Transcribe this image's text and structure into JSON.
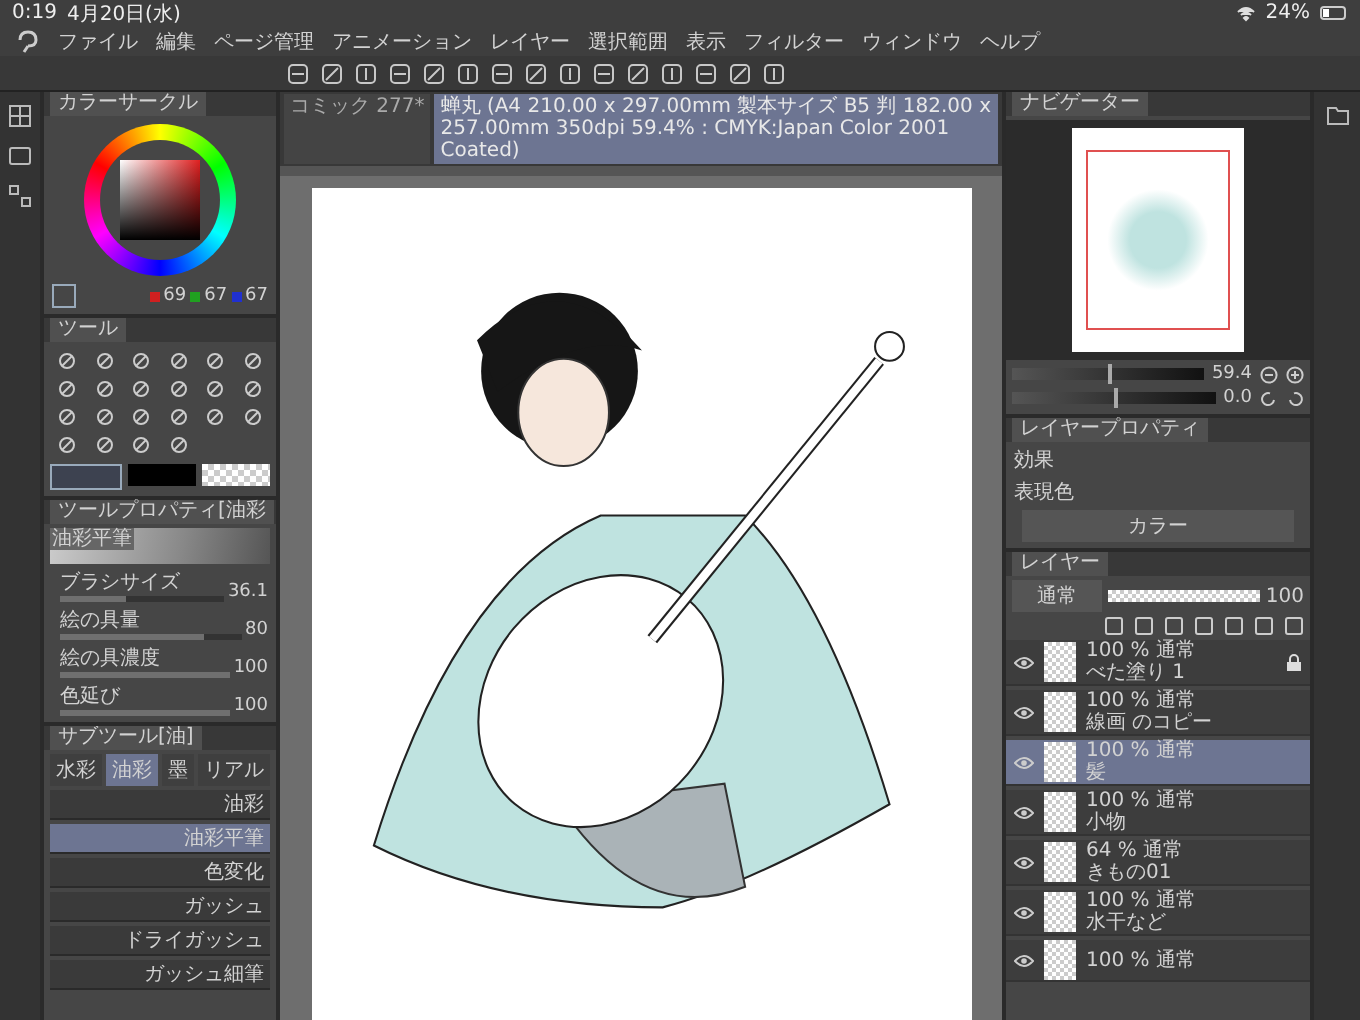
{
  "status_bar": {
    "time": "0:19",
    "date": "4月20日(水)",
    "battery": "24%"
  },
  "menu": [
    "ファイル",
    "編集",
    "ページ管理",
    "アニメーション",
    "レイヤー",
    "選択範囲",
    "表示",
    "フィルター",
    "ウィンドウ",
    "ヘルプ"
  ],
  "document_tabs": [
    {
      "label": "コミック 277*",
      "selected": false
    },
    {
      "label": "蝉丸 (A4 210.00 x 297.00mm 製本サイズ B5 判 182.00 x 257.00mm 350dpi 59.4% : CMYK:Japan Color 2001 Coated)",
      "selected": true
    }
  ],
  "color_circle": {
    "title": "カラーサークル",
    "values": [
      {
        "value": "69",
        "color": "#d02020"
      },
      {
        "value": "67",
        "color": "#20a020"
      },
      {
        "value": "67",
        "color": "#2030d0"
      }
    ]
  },
  "tool_panel": {
    "title": "ツール"
  },
  "tool_property": {
    "title": "ツールプロパティ[油彩",
    "preview_label": "油彩平筆",
    "rows": [
      {
        "label": "ブラシサイズ",
        "value": "36.1",
        "level": 0.4
      },
      {
        "label": "絵の具量",
        "value": "80",
        "level": 0.8
      },
      {
        "label": "絵の具濃度",
        "value": "100",
        "level": 1
      },
      {
        "label": "色延び",
        "value": "100",
        "level": 1
      }
    ]
  },
  "sub_tool": {
    "title": "サブツール[油]",
    "groups": [
      {
        "label": "水彩",
        "selected": false
      },
      {
        "label": "油彩",
        "selected": true
      },
      {
        "label": "墨",
        "selected": false
      },
      {
        "label": "リアル",
        "selected": false
      }
    ],
    "brushes": [
      {
        "label": "油彩",
        "selected": false
      },
      {
        "label": "油彩平筆",
        "selected": true
      },
      {
        "label": "色変化",
        "selected": false
      },
      {
        "label": "ガッシュ",
        "selected": false
      },
      {
        "label": "ドライガッシュ",
        "selected": false
      },
      {
        "label": "ガッシュ細筆",
        "selected": false
      }
    ]
  },
  "navigator": {
    "title": "ナビゲーター",
    "zoom": "59.4",
    "zoom_slider": {
      "level": 0.5
    },
    "angle": "0.0",
    "angle_slider": {
      "level": 0.5
    }
  },
  "layer_property": {
    "title": "レイヤープロパティ",
    "effect_label": "効果",
    "color_label": "表現色",
    "color_value": "カラー"
  },
  "layers": {
    "title": "レイヤー",
    "blend_mode": "通常",
    "opacity": "100",
    "opacity_bar": {
      "level": 1
    },
    "items": [
      {
        "info": "100 % 通常",
        "name": "べた塗り 1",
        "selected": false,
        "locked": true
      },
      {
        "info": "100 % 通常",
        "name": "線画 のコピー",
        "selected": false,
        "locked": false
      },
      {
        "info": "100 % 通常",
        "name": "髪",
        "selected": true,
        "locked": false
      },
      {
        "info": "100 % 通常",
        "name": "小物",
        "selected": false,
        "locked": false
      },
      {
        "info": "64 % 通常",
        "name": "きもの01",
        "selected": false,
        "locked": false
      },
      {
        "info": "100 % 通常",
        "name": "水干など",
        "selected": false,
        "locked": false
      },
      {
        "info": "100 % 通常",
        "selected": false,
        "locked": false
      }
    ]
  }
}
